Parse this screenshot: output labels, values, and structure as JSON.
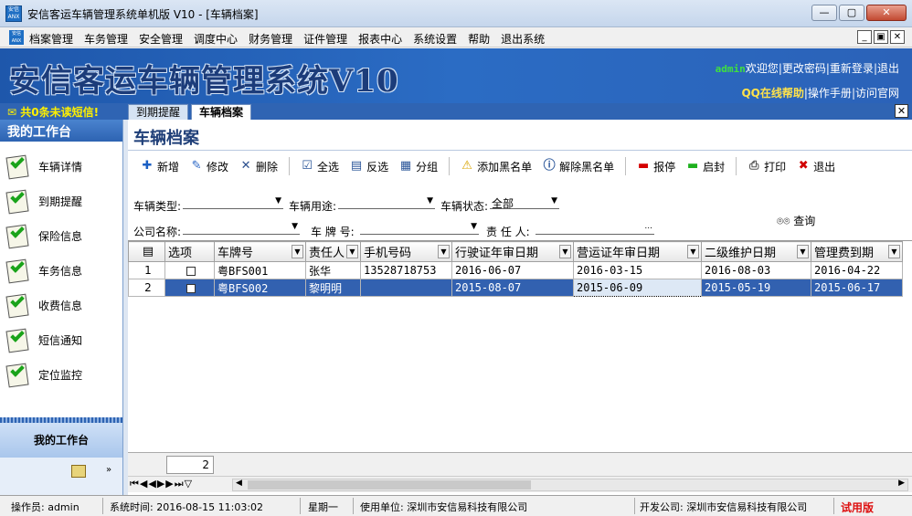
{
  "window": {
    "title": "安信客运车辆管理系统单机版 V10 - [车辆档案]",
    "min": "—",
    "max": "▢",
    "close": "✕"
  },
  "menu": [
    "档案管理",
    "车务管理",
    "安全管理",
    "调度中心",
    "财务管理",
    "证件管理",
    "报表中心",
    "系统设置",
    "帮助",
    "退出系统"
  ],
  "banner": {
    "logo": "安信客运车辆管理系统V10",
    "user": "admin",
    "welcome": "欢迎您",
    "change_pwd": "更改密码",
    "relogin": "重新登录",
    "logout": "退出",
    "qq_help": "QQ在线帮助",
    "manual": "操作手册",
    "website": "访问官网"
  },
  "sms_notice": "共0条未读短信!",
  "tabs": [
    "到期提醒",
    "车辆档案"
  ],
  "sidebar": {
    "title": "我的工作台",
    "items": [
      "车辆详情",
      "到期提醒",
      "保险信息",
      "车务信息",
      "收费信息",
      "短信通知",
      "定位监控"
    ],
    "footer": "我的工作台"
  },
  "page_title": "车辆档案",
  "toolbar": {
    "add": "新增",
    "edit": "修改",
    "delete": "删除",
    "select_all": "全选",
    "invert": "反选",
    "group": "分组",
    "add_blacklist": "添加黑名单",
    "remove_blacklist": "解除黑名单",
    "suspend": "报停",
    "resume": "启封",
    "print": "打印",
    "exit": "退出"
  },
  "filters": {
    "vehicle_type": "车辆类型:",
    "vehicle_use": "车辆用途:",
    "vehicle_status": "车辆状态:",
    "vehicle_status_value": "全部",
    "company": "公司名称:",
    "plate": "车 牌 号:",
    "owner": "责 任 人:",
    "owner_btn": "...",
    "query": "查询"
  },
  "grid": {
    "columns": [
      "选项",
      "车牌号",
      "责任人",
      "手机号码",
      "行驶证年审日期",
      "营运证年审日期",
      "二级维护日期",
      "管理费到期"
    ],
    "rows": [
      {
        "n": "1",
        "plate": "粤BFS001",
        "owner": "张华",
        "phone": "13528718753",
        "d1": "2016-06-07",
        "d2": "2016-03-15",
        "d3": "2016-08-03",
        "d4": "2016-04-22"
      },
      {
        "n": "2",
        "plate": "粤BFS002",
        "owner": "黎明明",
        "phone": "",
        "d1": "2015-08-07",
        "d2": "2015-06-09",
        "d3": "2015-05-19",
        "d4": "2015-06-17"
      }
    ],
    "count": "2"
  },
  "status": {
    "operator": "操作员: admin",
    "time": "系统时间: 2016-08-15 11:03:02",
    "weekday": "星期一",
    "user_unit": "使用单位: 深圳市安信易科技有限公司",
    "developer": "开发公司: 深圳市安信易科技有限公司",
    "trial": "试用版"
  }
}
